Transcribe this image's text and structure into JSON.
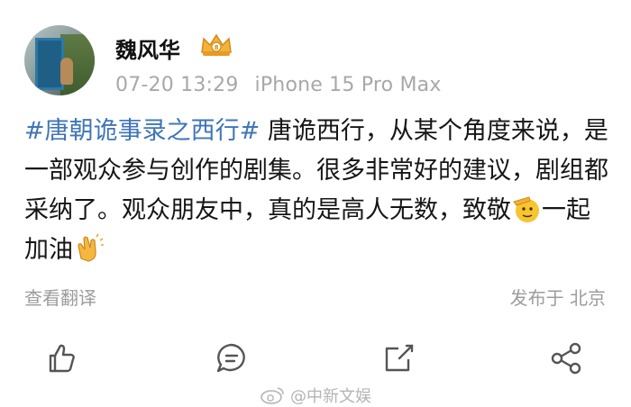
{
  "user": {
    "name": "魏风华",
    "badge_icon": "crown-badge-icon"
  },
  "meta": {
    "time": "07-20 13:29",
    "device": "iPhone 15 Pro Max"
  },
  "post": {
    "hashtag": "#唐朝诡事录之西行#",
    "text_before_emoji1": " 唐诡西行，从某个角度来说，是一部观众参与创作的剧集。很多非常好的建议，剧组都采纳了。观众朋友中，真的是高人无数，致敬",
    "emoji1": "salute-emoji-icon",
    "text_between": "一起加油",
    "emoji2": "clapping-hands-emoji-icon"
  },
  "translate_label": "查看翻译",
  "location_label": "发布于 北京",
  "actions": [
    "like-icon",
    "comment-icon",
    "share-icon",
    "more-share-icon"
  ],
  "watermark": {
    "text": "@中新文娱",
    "icon": "weibo-eye-icon"
  },
  "colors": {
    "hashtag": "#3f75b8",
    "meta": "#a8a8a8",
    "icon": "#555555"
  }
}
